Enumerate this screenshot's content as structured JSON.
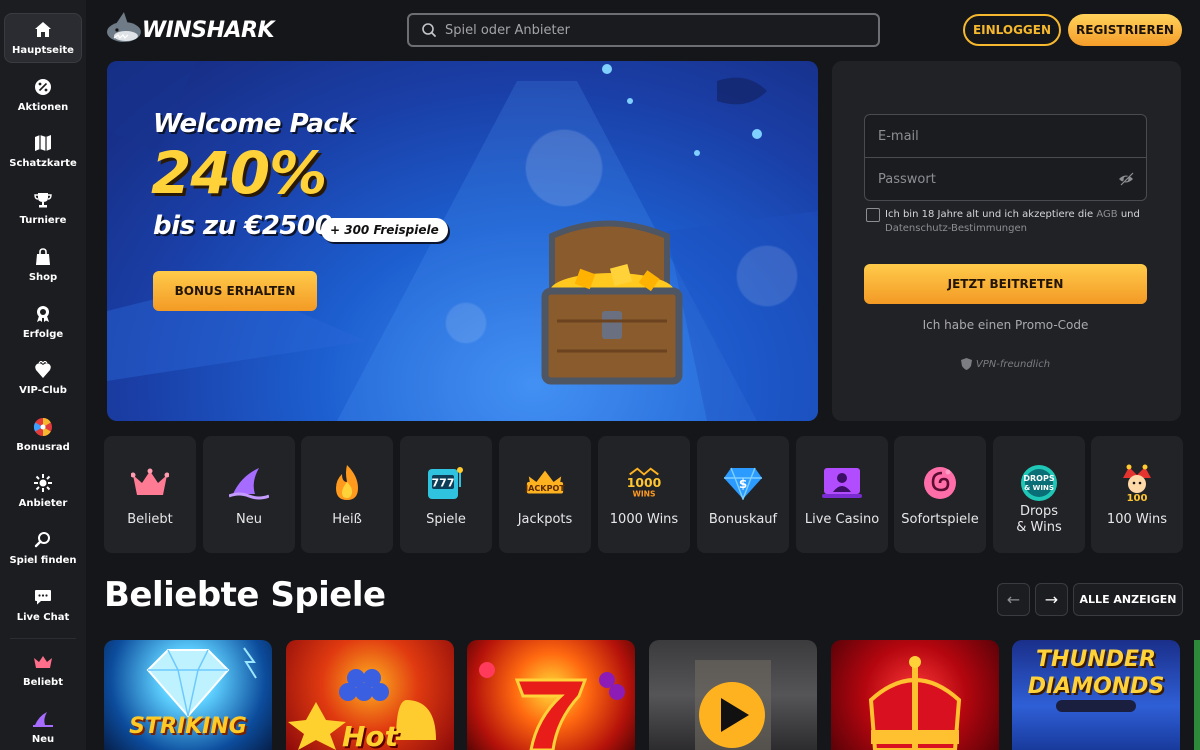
{
  "sidebar": {
    "items": [
      {
        "label": "Hauptseite",
        "icon": "home-icon"
      },
      {
        "label": "Aktionen",
        "icon": "percent-icon"
      },
      {
        "label": "Schatzkarte",
        "icon": "map-icon"
      },
      {
        "label": "Turniere",
        "icon": "trophy-icon"
      },
      {
        "label": "Shop",
        "icon": "shopping-bag-icon"
      },
      {
        "label": "Erfolge",
        "icon": "medal-icon"
      },
      {
        "label": "VIP-Club",
        "icon": "vip-heart-icon"
      },
      {
        "label": "Bonusrad",
        "icon": "wheel-icon"
      },
      {
        "label": "Anbieter",
        "icon": "provider-icon"
      },
      {
        "label": "Spiel finden",
        "icon": "search-icon"
      },
      {
        "label": "Live Chat",
        "icon": "chat-icon"
      },
      {
        "label": "Beliebt",
        "icon": "crown-icon"
      },
      {
        "label": "Neu",
        "icon": "shark-fin-icon"
      }
    ]
  },
  "header": {
    "logo_text": "WINSHARK",
    "search_placeholder": "Spiel oder Anbieter",
    "login_label": "EINLOGGEN",
    "register_label": "REGISTRIEREN"
  },
  "hero": {
    "line1": "Welcome Pack",
    "line2": "240%",
    "line3": "bis zu €2500",
    "badge": "+ 300 Freispiele",
    "cta": "BONUS ERHALTEN"
  },
  "register_panel": {
    "email_placeholder": "E-mail",
    "password_placeholder": "Passwort",
    "terms_text": "Ich bin 18 Jahre alt und ich akzeptiere die ",
    "terms_link1": "AGB",
    "terms_and": " und",
    "terms_link2": "Datenschutz-Bestimmungen",
    "join_label": "JETZT BEITRETEN",
    "promo_label": "Ich habe einen Promo-Code",
    "vpn_label": "VPN-freundlich"
  },
  "categories": [
    {
      "label": "Beliebt",
      "icon": "crown-icon"
    },
    {
      "label": "Neu",
      "icon": "shark-fin-icon"
    },
    {
      "label": "Heiß",
      "icon": "flame-icon"
    },
    {
      "label": "Spiele",
      "icon": "slot-machine-icon"
    },
    {
      "label": "Jackpots",
      "icon": "jackpot-crown-icon"
    },
    {
      "label": "1000 Wins",
      "icon": "1000-wins-icon"
    },
    {
      "label": "Bonuskauf",
      "icon": "diamond-dollar-icon"
    },
    {
      "label": "Live Casino",
      "icon": "live-dealer-icon"
    },
    {
      "label": "Sofortspiele",
      "icon": "spiral-icon"
    },
    {
      "label": "Drops & Wins",
      "icon": "drops-wins-icon"
    },
    {
      "label": "100 Wins",
      "icon": "jester-100-icon"
    }
  ],
  "section": {
    "title": "Beliebte Spiele",
    "all_label": "ALLE ANZEIGEN",
    "prev_arrow": "←",
    "next_arrow": "→"
  },
  "games": [
    {
      "name": "STRIKING"
    },
    {
      "name": "Hot"
    },
    {
      "name": ""
    },
    {
      "name": ""
    },
    {
      "name": ""
    },
    {
      "name": "THUNDER DIAMONDS"
    }
  ],
  "colors": {
    "accent": "#f5b82e",
    "background": "#151619",
    "panel": "#212226",
    "sidebar": "#1c1d21"
  }
}
